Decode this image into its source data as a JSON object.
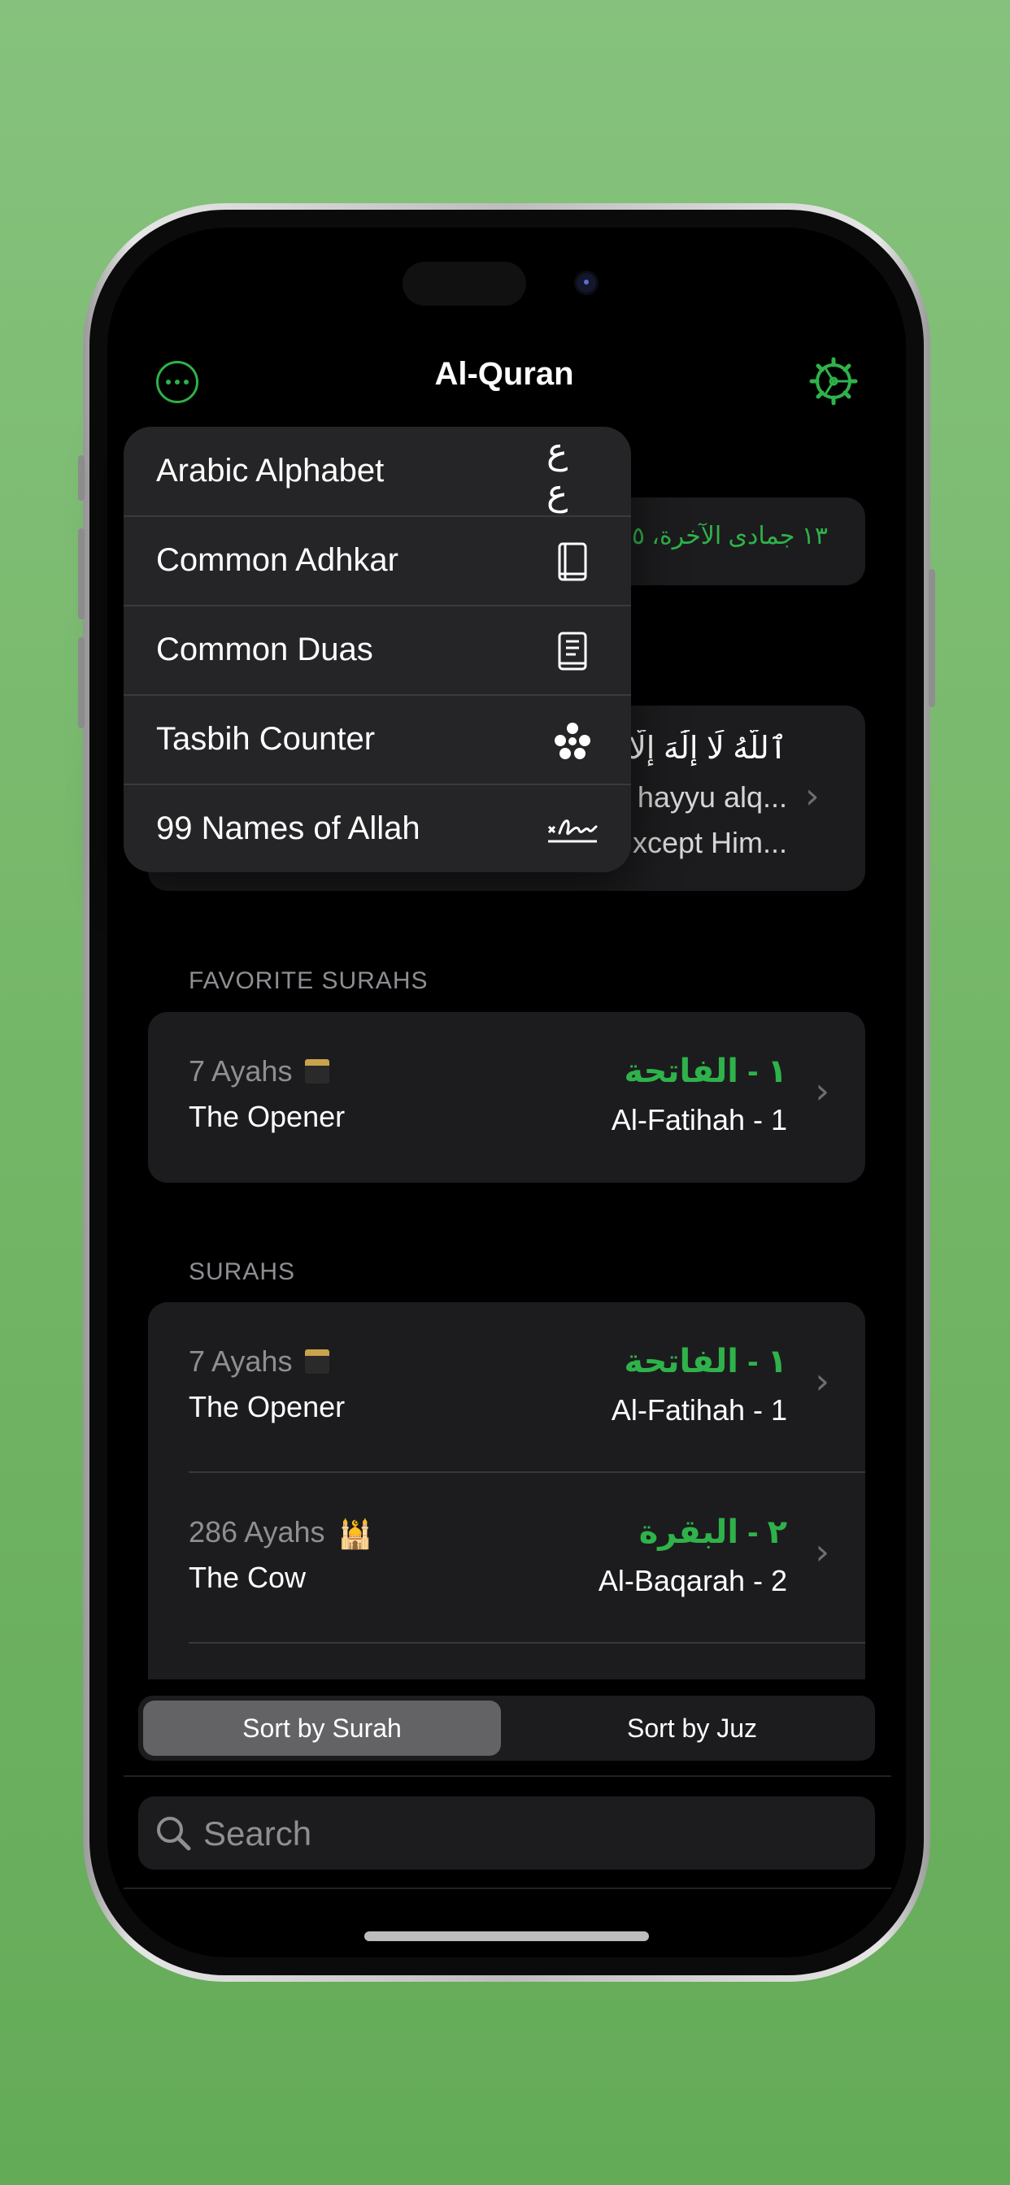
{
  "nav": {
    "title": "Al-Quran",
    "more_icon": "ellipsis-circle-icon",
    "settings_icon": "gear-icon"
  },
  "menu": {
    "items": [
      {
        "label": "Arabic Alphabet",
        "icon": "arabic-letters-icon",
        "glyph": "ع ع"
      },
      {
        "label": "Common Adhkar",
        "icon": "book-icon"
      },
      {
        "label": "Common Duas",
        "icon": "book-pages-icon"
      },
      {
        "label": "Tasbih Counter",
        "icon": "beads-icon"
      },
      {
        "label": "99 Names of Allah",
        "icon": "signature-icon"
      }
    ]
  },
  "date_card": {
    "hijri_date": "١٣ جمادى الآخرة، ٥"
  },
  "verse_card": {
    "arabic": "ٱللَّهُ لَا إِلَٰهَ إِلَّا هُوَ",
    "transliteration": "hayyu alq...",
    "translation": "xcept Him..."
  },
  "favorites": {
    "header": "FAVORITE SURAHS",
    "rows": [
      {
        "ayahs": "7 Ayahs",
        "english": "The Opener",
        "arabic": "١ - الفاتحة",
        "transliteration": "Al-Fatihah - 1",
        "badge_icon": "kaaba-icon"
      }
    ]
  },
  "surahs": {
    "header": "SURAHS",
    "rows": [
      {
        "ayahs": "7 Ayahs",
        "english": "The Opener",
        "arabic": "١ - الفاتحة",
        "transliteration": "Al-Fatihah - 1",
        "badge_icon": "kaaba-icon"
      },
      {
        "ayahs": "286 Ayahs",
        "english": "The Cow",
        "arabic": "٢ - البقرة",
        "transliteration": "Al-Baqarah - 2",
        "badge_icon": "mosque-icon"
      }
    ]
  },
  "sort": {
    "options": [
      "Sort by Surah",
      "Sort by Juz"
    ],
    "selected": "Sort by Surah"
  },
  "search": {
    "placeholder": "Search",
    "value": ""
  },
  "colors": {
    "accent": "#2fb24a",
    "background": "#000000",
    "card": "#1c1c1e",
    "wallpaper": "#72b565"
  }
}
